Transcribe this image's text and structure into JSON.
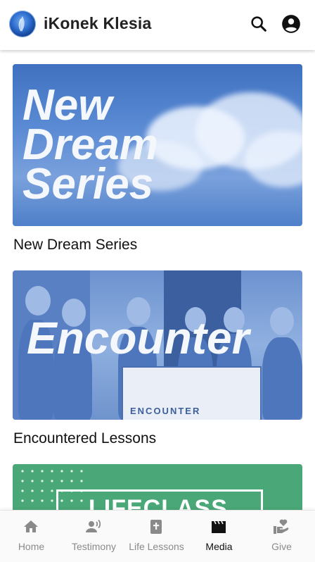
{
  "app": {
    "title": "iKonek Klesia"
  },
  "header": {
    "search_icon": "search-icon",
    "account_icon": "account-circle-icon"
  },
  "feed": {
    "cards": [
      {
        "title": "New Dream Series",
        "image_text": [
          "New",
          "Dream",
          "Series"
        ]
      },
      {
        "title": "Encountered Lessons",
        "image_text": "Encounter",
        "banner_text": "ENCOUNTER"
      },
      {
        "title": "",
        "image_text": "LIFECLASS"
      }
    ]
  },
  "bottom_nav": {
    "items": [
      {
        "label": "Home",
        "icon": "home-icon"
      },
      {
        "label": "Testimony",
        "icon": "testimony-icon"
      },
      {
        "label": "Life Lessons",
        "icon": "bible-icon"
      },
      {
        "label": "Media",
        "icon": "movie-icon",
        "active": true
      },
      {
        "label": "Give",
        "icon": "give-heart-icon"
      }
    ]
  },
  "colors": {
    "card_blue": "#4e7fc9",
    "card_green": "#4aa878",
    "nav_inactive": "#8a8a8a",
    "nav_active": "#111111"
  }
}
